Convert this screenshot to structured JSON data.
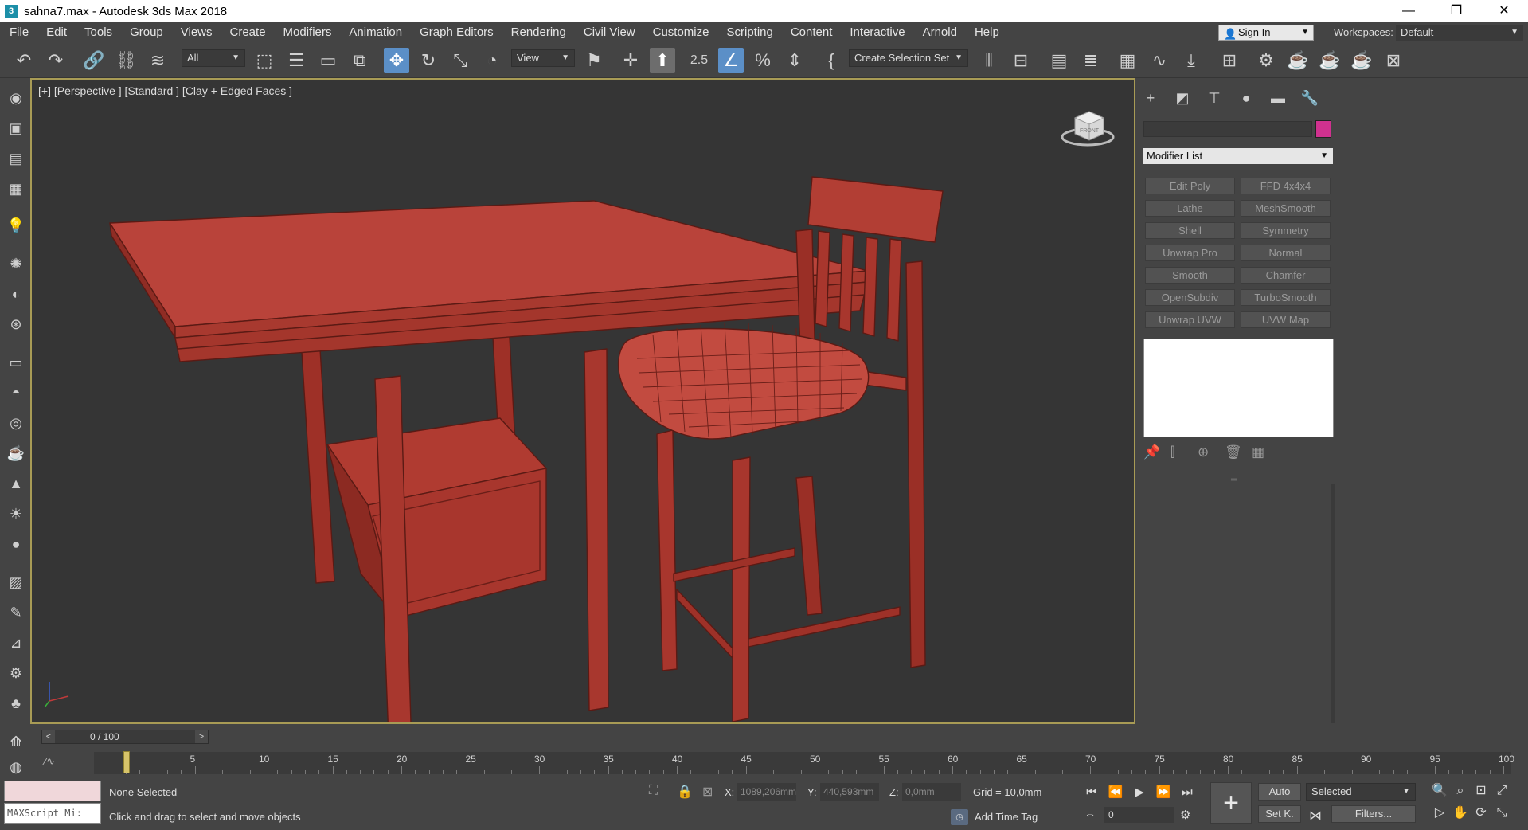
{
  "window": {
    "title": "sahna7.max - Autodesk 3ds Max 2018",
    "app_icon": "3",
    "minimize": "—",
    "restore": "❐",
    "close": "✕"
  },
  "menu": [
    "File",
    "Edit",
    "Tools",
    "Group",
    "Views",
    "Create",
    "Modifiers",
    "Animation",
    "Graph Editors",
    "Rendering",
    "Civil View",
    "Customize",
    "Scripting",
    "Content",
    "Interactive",
    "Arnold",
    "Help"
  ],
  "account": {
    "sign_in": "Sign In",
    "workspaces_label": "Workspaces:",
    "workspace": "Default"
  },
  "toolbar": {
    "selection_filter": "All",
    "ref_coord": "View",
    "named_selection": "Create Selection Set",
    "angle_snap_label": "2.5"
  },
  "viewport": {
    "label": "[+] [Perspective ] [Standard ] [Clay + Edged Faces ]",
    "model_color": "#c4463d",
    "background": "#353535",
    "active_border": "#a89b55",
    "viewcube_face": "FRONT"
  },
  "command_panel": {
    "object_color": "#d0318f",
    "modifier_list": "Modifier List",
    "modifiers": [
      "Edit Poly",
      "FFD 4x4x4",
      "Lathe",
      "MeshSmooth",
      "Shell",
      "Symmetry",
      "Unwrap Pro",
      "Normal",
      "Smooth",
      "Chamfer",
      "OpenSubdiv",
      "TurboSmooth",
      "Unwrap UVW",
      "UVW Map"
    ]
  },
  "timeline": {
    "frame_display": "0 / 100",
    "prev": "<",
    "next": ">",
    "ticks": [
      "5",
      "10",
      "15",
      "20",
      "25",
      "30",
      "35",
      "40",
      "45",
      "50",
      "55",
      "60",
      "65",
      "70",
      "75",
      "80",
      "85",
      "90",
      "95",
      "100"
    ]
  },
  "status": {
    "selection": "None Selected",
    "prompt": "Click and drag to select and move objects",
    "maxscript": "MAXScript Mi:",
    "x_label": "X:",
    "x_value": "1089,206mm",
    "y_label": "Y:",
    "y_value": "440,593mm",
    "z_label": "Z:",
    "z_value": "0,0mm",
    "grid": "Grid = 10,0mm",
    "add_time_tag": "Add Time Tag",
    "current_frame": "0",
    "auto_key": "Auto",
    "set_key": "Set K.",
    "key_filter_sel": "Selected",
    "filters": "Filters..."
  }
}
